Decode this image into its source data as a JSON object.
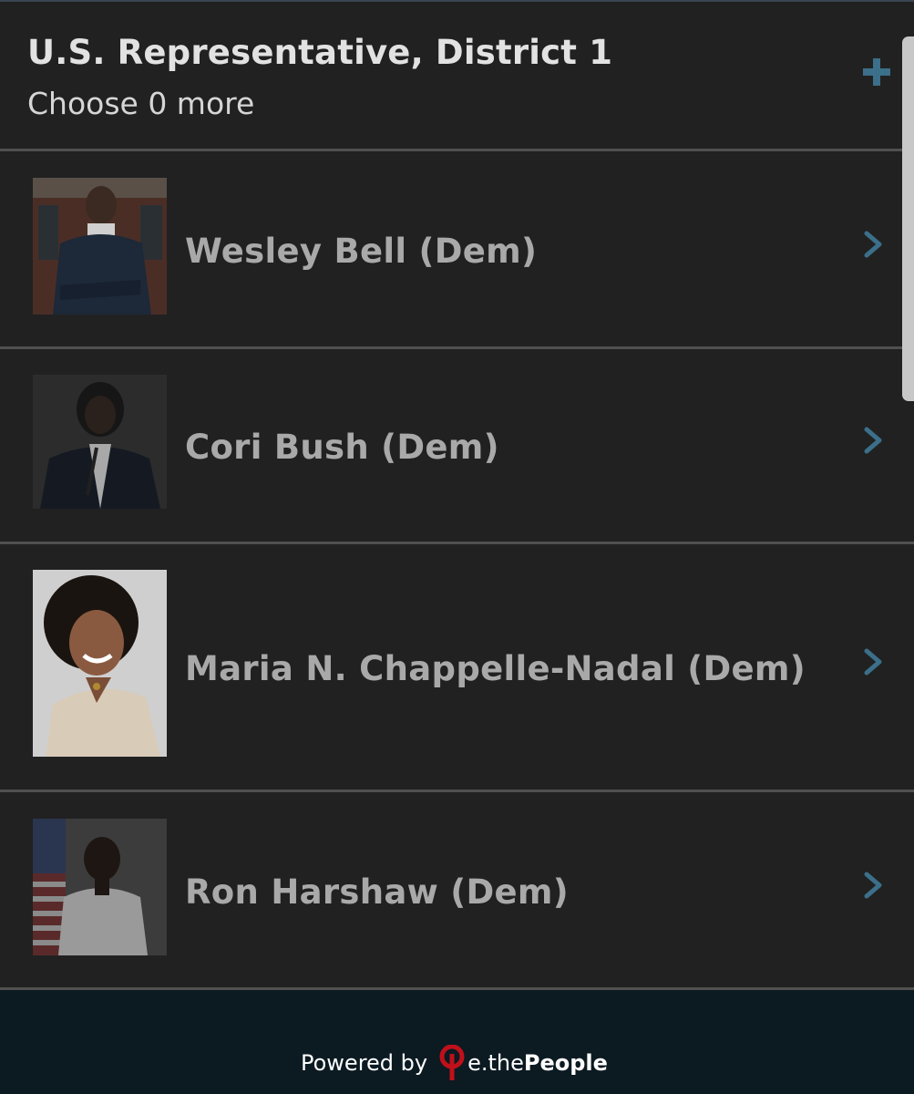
{
  "race": {
    "title": "U.S. Representative, District 1",
    "subtitle": "Choose 0 more",
    "add_icon": "plus-icon",
    "accent_color": "#3b6f8a"
  },
  "candidates": [
    {
      "name": "Wesley Bell (Dem)",
      "photo": "candidate-photo",
      "chevron": "chevron-right-icon"
    },
    {
      "name": "Cori Bush (Dem)",
      "photo": "candidate-photo",
      "chevron": "chevron-right-icon"
    },
    {
      "name": "Maria N. Chappelle-Nadal (Dem)",
      "photo": "candidate-photo",
      "chevron": "chevron-right-icon"
    },
    {
      "name": "Ron Harshaw (Dem)",
      "photo": "candidate-photo",
      "chevron": "chevron-right-icon"
    }
  ],
  "footer": {
    "powered_label": "Powered by",
    "brand_prefix": "e.the",
    "brand_strong": "People",
    "logo_icon": "ethepeople-logo-icon",
    "logo_color": "#c0101a",
    "background": "#0c1a22"
  }
}
